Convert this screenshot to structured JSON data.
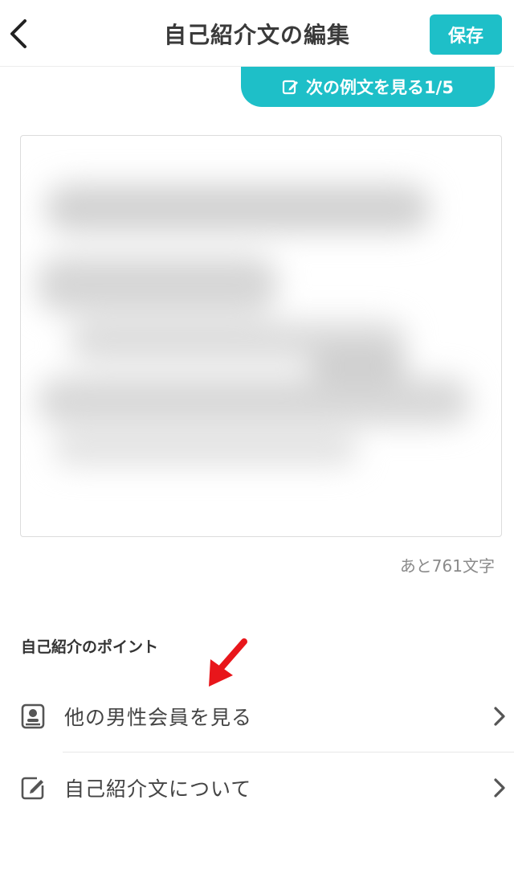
{
  "header": {
    "title": "自己紹介文の編集",
    "save_label": "保存"
  },
  "example_button": {
    "label": "次の例文を見る1/5"
  },
  "editor": {
    "remaining_text": "あと761文字"
  },
  "points": {
    "title": "自己紹介のポイント",
    "items": [
      {
        "label": "他の男性会員を見る",
        "icon": "member-card-icon"
      },
      {
        "label": "自己紹介文について",
        "icon": "edit-note-icon"
      }
    ]
  },
  "colors": {
    "accent": "#1ebfc8",
    "annotation_arrow": "#e8161b"
  }
}
